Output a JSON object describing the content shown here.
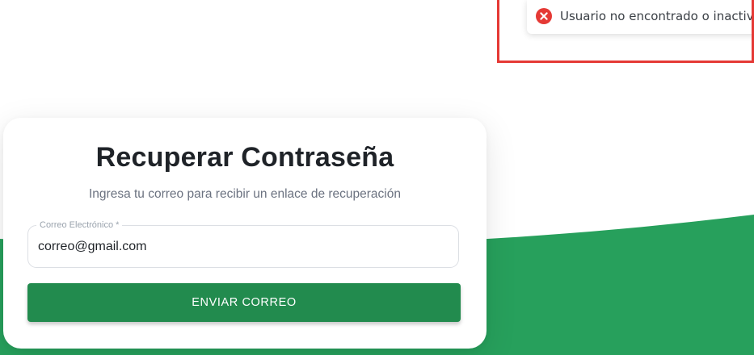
{
  "recovery_form": {
    "title": "Recuperar Contraseña",
    "subtitle": "Ingresa tu correo para recibir un enlace de recuperación",
    "email_label": "Correo Electrónico *",
    "email_value": "correo@gmail.com",
    "submit_label": "ENVIAR CORREO"
  },
  "toast": {
    "message": "Usuario no encontrado o inactivo",
    "icon": "error-circle-x-icon"
  },
  "colors": {
    "brand_green": "#228b4e",
    "background_green": "#27a05c",
    "error_red": "#e53935"
  }
}
